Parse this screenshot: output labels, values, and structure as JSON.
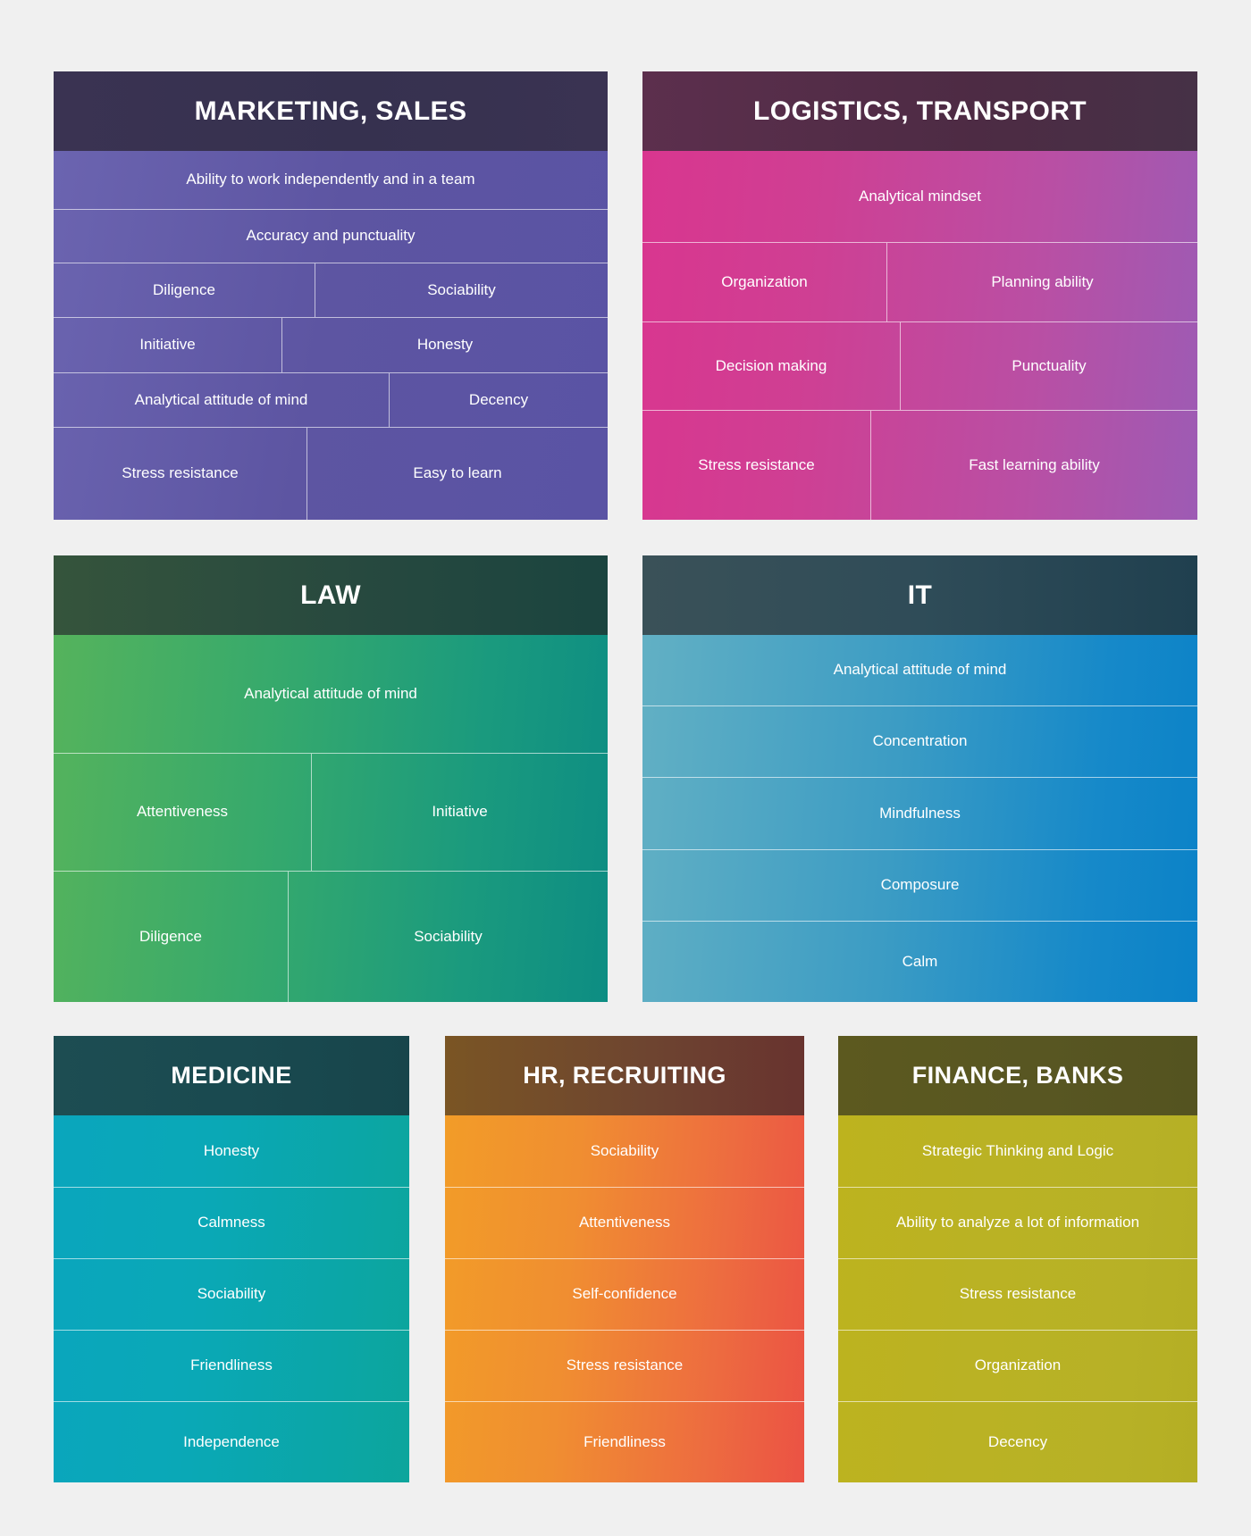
{
  "background_color": "#f0f0f0",
  "panels": [
    {
      "id": "marketing",
      "title": "MARKETING, SALES",
      "header_color": "#36314f",
      "body_color": "#5d55a2",
      "rows": [
        {
          "cells": [
            {
              "label": "Ability to work independently and in a team",
              "width_pct": 100
            }
          ]
        },
        {
          "cells": [
            {
              "label": "Accuracy and punctuality",
              "width_pct": 100
            }
          ]
        },
        {
          "cells": [
            {
              "label": "Diligence",
              "width_pct": 52
            },
            {
              "label": "Sociability",
              "width_pct": 48
            }
          ]
        },
        {
          "cells": [
            {
              "label": "Initiative",
              "width_pct": 45
            },
            {
              "label": "Honesty",
              "width_pct": 55
            }
          ]
        },
        {
          "cells": [
            {
              "label": "Analytical attitude of mind",
              "width_pct": 67
            },
            {
              "label": "Decency",
              "width_pct": 33
            }
          ]
        },
        {
          "cells": [
            {
              "label": "Stress resistance",
              "width_pct": 47
            },
            {
              "label": "Easy to learn",
              "width_pct": 53
            }
          ]
        }
      ]
    },
    {
      "id": "logistics",
      "title": "LOGISTICS, TRANSPORT",
      "header_color": "#4d2b44",
      "body_color": "#c6439b",
      "rows": [
        {
          "cells": [
            {
              "label": "Analytical mindset",
              "width_pct": 100
            }
          ]
        },
        {
          "cells": [
            {
              "label": "Organization",
              "width_pct": 48
            },
            {
              "label": "Planning ability",
              "width_pct": 52
            }
          ]
        },
        {
          "cells": [
            {
              "label": "Decision making",
              "width_pct": 51
            },
            {
              "label": "Punctuality",
              "width_pct": 49
            }
          ]
        },
        {
          "cells": [
            {
              "label": "Stress resistance",
              "width_pct": 41
            },
            {
              "label": "Fast learning ability",
              "width_pct": 59
            }
          ]
        }
      ]
    },
    {
      "id": "law",
      "title": "LAW",
      "header_color": "#27493f",
      "body_color": "#2ba072",
      "rows": [
        {
          "cells": [
            {
              "label": "Analytical attitude of mind",
              "width_pct": 100
            }
          ]
        },
        {
          "cells": [
            {
              "label": "Attentiveness",
              "width_pct": 52
            },
            {
              "label": "Initiative",
              "width_pct": 48
            }
          ]
        },
        {
          "cells": [
            {
              "label": "Diligence",
              "width_pct": 47
            },
            {
              "label": "Sociability",
              "width_pct": 53
            }
          ]
        }
      ]
    },
    {
      "id": "it",
      "title": "IT",
      "header_color": "#2f4c58",
      "body_color": "#2a92c6",
      "rows": [
        {
          "cells": [
            {
              "label": "Analytical attitude of mind",
              "width_pct": 100
            }
          ]
        },
        {
          "cells": [
            {
              "label": "Concentration",
              "width_pct": 100
            }
          ]
        },
        {
          "cells": [
            {
              "label": "Mindfulness",
              "width_pct": 100
            }
          ]
        },
        {
          "cells": [
            {
              "label": "Composure",
              "width_pct": 100
            }
          ]
        },
        {
          "cells": [
            {
              "label": "Calm",
              "width_pct": 100
            }
          ]
        }
      ]
    },
    {
      "id": "medicine",
      "title": "MEDICINE",
      "header_color": "#1a4a50",
      "body_color": "#0aa7ad",
      "rows": [
        {
          "cells": [
            {
              "label": "Honesty",
              "width_pct": 100
            }
          ]
        },
        {
          "cells": [
            {
              "label": "Calmness",
              "width_pct": 100
            }
          ]
        },
        {
          "cells": [
            {
              "label": "Sociability",
              "width_pct": 100
            }
          ]
        },
        {
          "cells": [
            {
              "label": "Friendliness",
              "width_pct": 100
            }
          ]
        },
        {
          "cells": [
            {
              "label": "Independence",
              "width_pct": 100
            }
          ]
        }
      ]
    },
    {
      "id": "hr",
      "title": "HR, RECRUITING",
      "header_color": "#6e4530",
      "body_color": "#ef7f37",
      "rows": [
        {
          "cells": [
            {
              "label": "Sociability",
              "width_pct": 100
            }
          ]
        },
        {
          "cells": [
            {
              "label": "Attentiveness",
              "width_pct": 100
            }
          ]
        },
        {
          "cells": [
            {
              "label": "Self-confidence",
              "width_pct": 100
            }
          ]
        },
        {
          "cells": [
            {
              "label": "Stress resistance",
              "width_pct": 100
            }
          ]
        },
        {
          "cells": [
            {
              "label": "Friendliness",
              "width_pct": 100
            }
          ]
        }
      ]
    },
    {
      "id": "finance",
      "title": "FINANCE, BANKS",
      "header_color": "#585622",
      "body_color": "#b9b122",
      "rows": [
        {
          "cells": [
            {
              "label": "Strategic Thinking and Logic",
              "width_pct": 100
            }
          ]
        },
        {
          "cells": [
            {
              "label": "Ability to analyze a lot of information",
              "width_pct": 100
            }
          ]
        },
        {
          "cells": [
            {
              "label": "Stress resistance",
              "width_pct": 100
            }
          ]
        },
        {
          "cells": [
            {
              "label": "Organization",
              "width_pct": 100
            }
          ]
        },
        {
          "cells": [
            {
              "label": "Decency",
              "width_pct": 100
            }
          ]
        }
      ]
    }
  ]
}
